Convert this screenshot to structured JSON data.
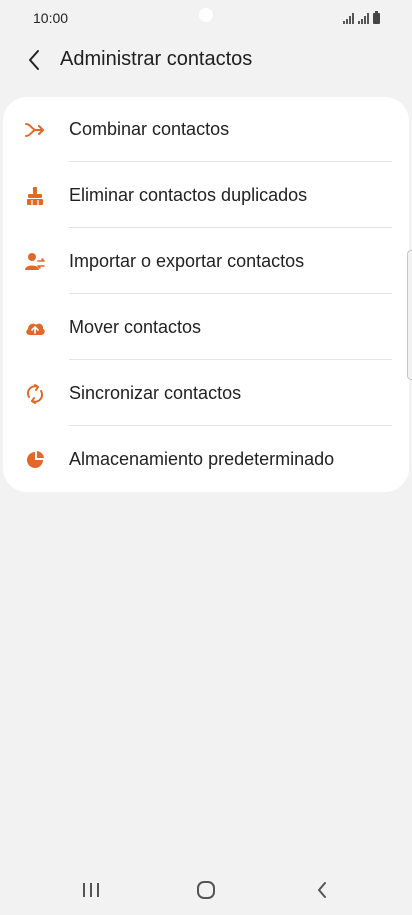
{
  "status_bar": {
    "time": "10:00"
  },
  "header": {
    "title": "Administrar contactos"
  },
  "menu": {
    "items": [
      {
        "id": "combine",
        "label": "Combinar contactos",
        "icon": "merge-arrow-icon"
      },
      {
        "id": "remove-duplicates",
        "label": "Eliminar contactos duplicados",
        "icon": "broom-icon"
      },
      {
        "id": "import-export",
        "label": "Importar o exportar contactos",
        "icon": "person-transfer-icon"
      },
      {
        "id": "move",
        "label": "Mover contactos",
        "icon": "cloud-upload-icon"
      },
      {
        "id": "sync",
        "label": "Sincronizar contactos",
        "icon": "sync-icon"
      },
      {
        "id": "default-storage",
        "label": "Almacenamiento predeterminado",
        "icon": "pie-storage-icon"
      }
    ]
  },
  "colors": {
    "accent": "#e0692a",
    "background": "#f2f2f2",
    "card": "#ffffff",
    "text": "#222222",
    "divider": "#e4e4e4"
  },
  "nav_bar": {
    "recent_icon": "recent-apps-icon",
    "home_icon": "home-icon",
    "back_icon": "back-icon"
  }
}
